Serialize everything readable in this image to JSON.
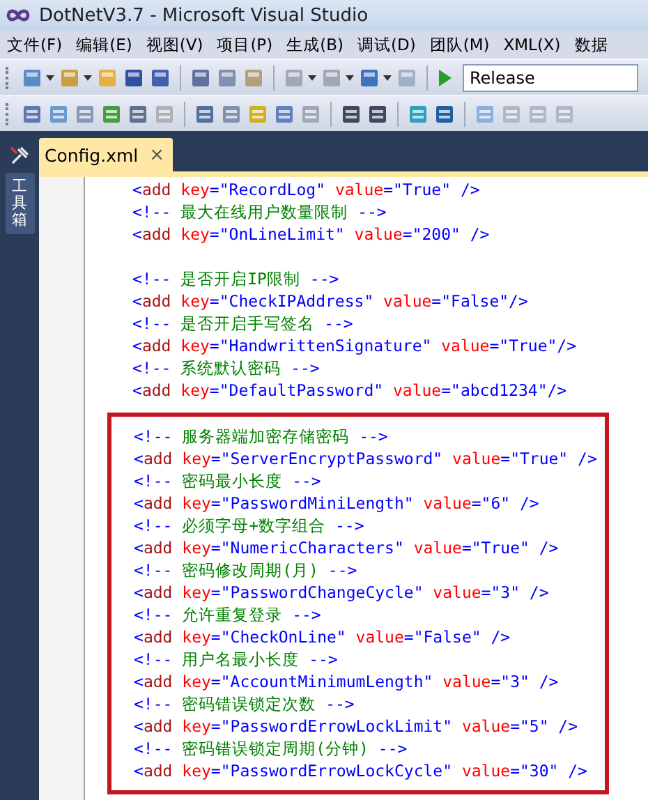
{
  "window": {
    "title": "DotNetV3.7 - Microsoft Visual Studio"
  },
  "menu": [
    "文件(F)",
    "编辑(E)",
    "视图(V)",
    "项目(P)",
    "生成(B)",
    "调试(D)",
    "团队(M)",
    "XML(X)",
    "数据"
  ],
  "toolbar": {
    "configuration": "Release"
  },
  "toolbox_tab": {
    "label": "工具箱"
  },
  "tabs": [
    {
      "label": "Config.xml",
      "close": "×",
      "selected": true
    }
  ],
  "editor": {
    "lines": [
      {
        "tokens": [
          {
            "kind": "punct",
            "t": "<"
          },
          {
            "kind": "elem",
            "t": "add"
          },
          {
            "kind": "attr",
            "t": " key"
          },
          {
            "kind": "punct",
            "t": "=\"RecordLog\""
          },
          {
            "kind": "attr",
            "t": " value"
          },
          {
            "kind": "punct",
            "t": "=\"True\" />"
          }
        ]
      },
      {
        "tokens": [
          {
            "kind": "punct",
            "t": "<!--"
          },
          {
            "kind": "comment",
            "t": " 最大在线用户数量限制 "
          },
          {
            "kind": "punct",
            "t": "-->"
          }
        ]
      },
      {
        "tokens": [
          {
            "kind": "punct",
            "t": "<"
          },
          {
            "kind": "elem",
            "t": "add"
          },
          {
            "kind": "attr",
            "t": " key"
          },
          {
            "kind": "punct",
            "t": "=\"OnLineLimit\""
          },
          {
            "kind": "attr",
            "t": " value"
          },
          {
            "kind": "punct",
            "t": "=\"200\" />"
          }
        ]
      },
      {
        "gap_before": true,
        "tokens": [
          {
            "kind": "punct",
            "t": "<!--"
          },
          {
            "kind": "comment",
            "t": " 是否开启IP限制 "
          },
          {
            "kind": "punct",
            "t": "-->"
          }
        ]
      },
      {
        "tokens": [
          {
            "kind": "punct",
            "t": "<"
          },
          {
            "kind": "elem",
            "t": "add"
          },
          {
            "kind": "attr",
            "t": " key"
          },
          {
            "kind": "punct",
            "t": "=\"CheckIPAddress\""
          },
          {
            "kind": "attr",
            "t": " value"
          },
          {
            "kind": "punct",
            "t": "=\"False\"/>"
          }
        ]
      },
      {
        "tokens": [
          {
            "kind": "punct",
            "t": "<!--"
          },
          {
            "kind": "comment",
            "t": " 是否开启手写签名 "
          },
          {
            "kind": "punct",
            "t": "-->"
          }
        ]
      },
      {
        "tokens": [
          {
            "kind": "punct",
            "t": "<"
          },
          {
            "kind": "elem",
            "t": "add"
          },
          {
            "kind": "attr",
            "t": " key"
          },
          {
            "kind": "punct",
            "t": "=\"HandwrittenSignature\""
          },
          {
            "kind": "attr",
            "t": " value"
          },
          {
            "kind": "punct",
            "t": "=\"True\"/>"
          }
        ]
      },
      {
        "tokens": [
          {
            "kind": "punct",
            "t": "<!--"
          },
          {
            "kind": "comment",
            "t": " 系统默认密码 "
          },
          {
            "kind": "punct",
            "t": "-->"
          }
        ]
      },
      {
        "tokens": [
          {
            "kind": "punct",
            "t": "<"
          },
          {
            "kind": "elem",
            "t": "add"
          },
          {
            "kind": "attr",
            "t": " key"
          },
          {
            "kind": "punct",
            "t": "=\"DefaultPassword\""
          },
          {
            "kind": "attr",
            "t": " value"
          },
          {
            "kind": "punct",
            "t": "=\"abcd1234\"/>"
          }
        ]
      }
    ],
    "highlighted_lines": [
      {
        "tokens": [
          {
            "kind": "punct",
            "t": "<!--"
          },
          {
            "kind": "comment",
            "t": " 服务器端加密存储密码 "
          },
          {
            "kind": "punct",
            "t": "-->"
          }
        ]
      },
      {
        "tokens": [
          {
            "kind": "punct",
            "t": "<"
          },
          {
            "kind": "elem",
            "t": "add"
          },
          {
            "kind": "attr",
            "t": " key"
          },
          {
            "kind": "punct",
            "t": "=\"ServerEncryptPassword\""
          },
          {
            "kind": "attr",
            "t": " value"
          },
          {
            "kind": "punct",
            "t": "=\"True\" />"
          }
        ]
      },
      {
        "tokens": [
          {
            "kind": "punct",
            "t": "<!--"
          },
          {
            "kind": "comment",
            "t": " 密码最小长度 "
          },
          {
            "kind": "punct",
            "t": "-->"
          }
        ]
      },
      {
        "tokens": [
          {
            "kind": "punct",
            "t": "<"
          },
          {
            "kind": "elem",
            "t": "add"
          },
          {
            "kind": "attr",
            "t": " key"
          },
          {
            "kind": "punct",
            "t": "=\"PasswordMiniLength\""
          },
          {
            "kind": "attr",
            "t": " value"
          },
          {
            "kind": "punct",
            "t": "=\"6\" />"
          }
        ]
      },
      {
        "tokens": [
          {
            "kind": "punct",
            "t": "<!--"
          },
          {
            "kind": "comment",
            "t": " 必须字母+数字组合 "
          },
          {
            "kind": "punct",
            "t": "-->"
          }
        ]
      },
      {
        "tokens": [
          {
            "kind": "punct",
            "t": "<"
          },
          {
            "kind": "elem",
            "t": "add"
          },
          {
            "kind": "attr",
            "t": " key"
          },
          {
            "kind": "punct",
            "t": "=\"NumericCharacters\""
          },
          {
            "kind": "attr",
            "t": " value"
          },
          {
            "kind": "punct",
            "t": "=\"True\" />"
          }
        ]
      },
      {
        "tokens": [
          {
            "kind": "punct",
            "t": "<!--"
          },
          {
            "kind": "comment",
            "t": " 密码修改周期(月) "
          },
          {
            "kind": "punct",
            "t": "-->"
          }
        ]
      },
      {
        "tokens": [
          {
            "kind": "punct",
            "t": "<"
          },
          {
            "kind": "elem",
            "t": "add"
          },
          {
            "kind": "attr",
            "t": " key"
          },
          {
            "kind": "punct",
            "t": "=\"PasswordChangeCycle\""
          },
          {
            "kind": "attr",
            "t": " value"
          },
          {
            "kind": "punct",
            "t": "=\"3\" />"
          }
        ]
      },
      {
        "tokens": [
          {
            "kind": "punct",
            "t": "<!--"
          },
          {
            "kind": "comment",
            "t": " 允许重复登录 "
          },
          {
            "kind": "punct",
            "t": "-->"
          }
        ]
      },
      {
        "tokens": [
          {
            "kind": "punct",
            "t": "<"
          },
          {
            "kind": "elem",
            "t": "add"
          },
          {
            "kind": "attr",
            "t": " key"
          },
          {
            "kind": "punct",
            "t": "=\"CheckOnLine\""
          },
          {
            "kind": "attr",
            "t": " value"
          },
          {
            "kind": "punct",
            "t": "=\"False\" />"
          }
        ]
      },
      {
        "tokens": [
          {
            "kind": "punct",
            "t": "<!--"
          },
          {
            "kind": "comment",
            "t": " 用户名最小长度 "
          },
          {
            "kind": "punct",
            "t": "-->"
          }
        ]
      },
      {
        "tokens": [
          {
            "kind": "punct",
            "t": "<"
          },
          {
            "kind": "elem",
            "t": "add"
          },
          {
            "kind": "attr",
            "t": " key"
          },
          {
            "kind": "punct",
            "t": "=\"AccountMinimumLength\""
          },
          {
            "kind": "attr",
            "t": " value"
          },
          {
            "kind": "punct",
            "t": "=\"3\" />"
          }
        ]
      },
      {
        "tokens": [
          {
            "kind": "punct",
            "t": "<!--"
          },
          {
            "kind": "comment",
            "t": " 密码错误锁定次数 "
          },
          {
            "kind": "punct",
            "t": "-->"
          }
        ]
      },
      {
        "tokens": [
          {
            "kind": "punct",
            "t": "<"
          },
          {
            "kind": "elem",
            "t": "add"
          },
          {
            "kind": "attr",
            "t": " key"
          },
          {
            "kind": "punct",
            "t": "=\"PasswordErrowLockLimit\""
          },
          {
            "kind": "attr",
            "t": " value"
          },
          {
            "kind": "punct",
            "t": "=\"5\" />"
          }
        ]
      },
      {
        "tokens": [
          {
            "kind": "punct",
            "t": "<!--"
          },
          {
            "kind": "comment",
            "t": " 密码错误锁定周期(分钟) "
          },
          {
            "kind": "punct",
            "t": "-->"
          }
        ]
      },
      {
        "tokens": [
          {
            "kind": "punct",
            "t": "<"
          },
          {
            "kind": "elem",
            "t": "add"
          },
          {
            "kind": "attr",
            "t": " key"
          },
          {
            "kind": "punct",
            "t": "=\"PasswordErrowLockCycle\""
          },
          {
            "kind": "attr",
            "t": " value"
          },
          {
            "kind": "punct",
            "t": "=\"30\" />"
          }
        ]
      }
    ]
  }
}
